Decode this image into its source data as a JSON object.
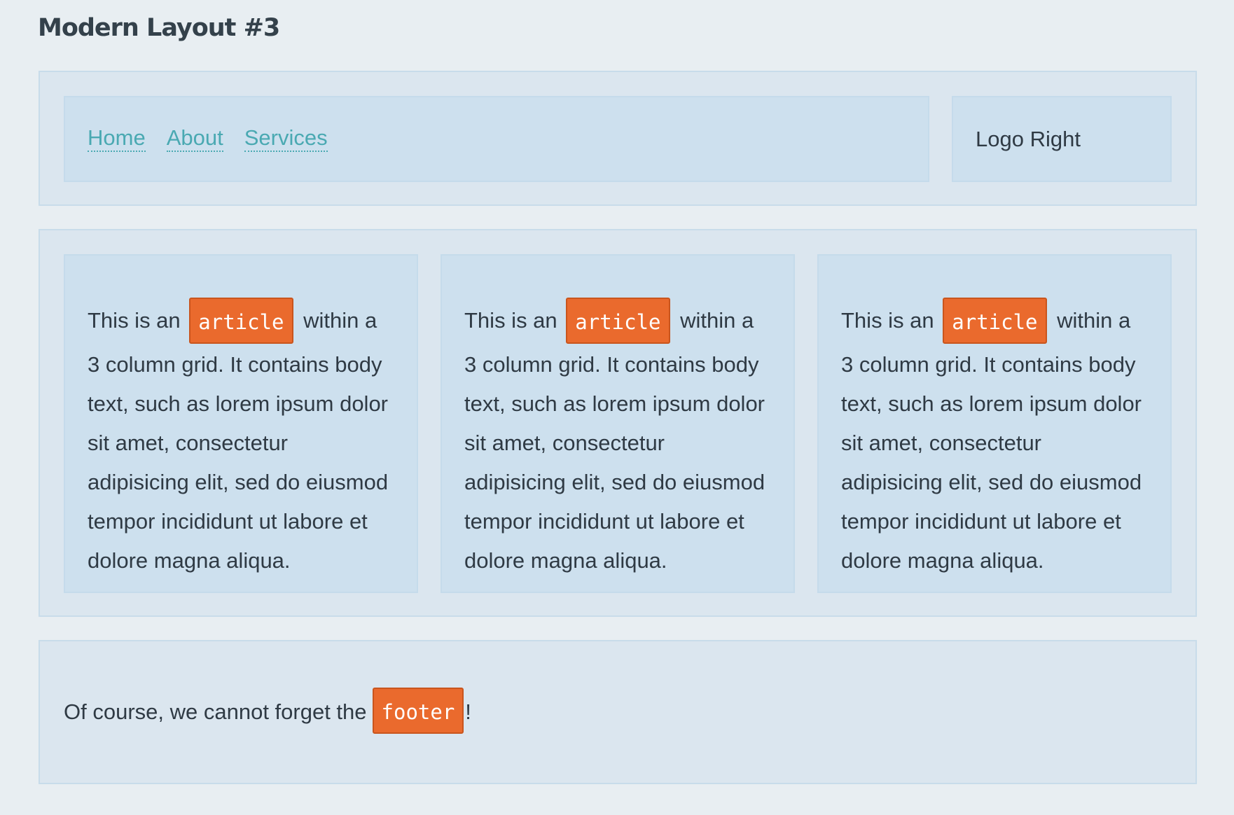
{
  "page": {
    "title": "Modern Layout #3"
  },
  "header": {
    "nav": [
      {
        "label": "Home"
      },
      {
        "label": "About"
      },
      {
        "label": "Services"
      }
    ],
    "logo_label": "Logo Right"
  },
  "articles": [
    {
      "prefix": "This is an",
      "tag": "article",
      "suffix": "within a 3 column grid. It contains body text, such as lorem ipsum dolor sit amet, consectetur adipisicing elit, sed do eiusmod tempor incididunt ut labore et dolore magna aliqua."
    },
    {
      "prefix": "This is an",
      "tag": "article",
      "suffix": "within a 3 column grid. It contains body text, such as lorem ipsum dolor sit amet, consectetur adipisicing elit, sed do eiusmod tempor incididunt ut labore et dolore magna aliqua."
    },
    {
      "prefix": "This is an",
      "tag": "article",
      "suffix": "within a 3 column grid. It contains body text, such as lorem ipsum dolor sit amet, consectetur adipisicing elit, sed do eiusmod tempor incididunt ut labore et dolore magna aliqua."
    }
  ],
  "footer": {
    "prefix": "Of course, we cannot forget the",
    "tag": "footer",
    "suffix": "!"
  }
}
